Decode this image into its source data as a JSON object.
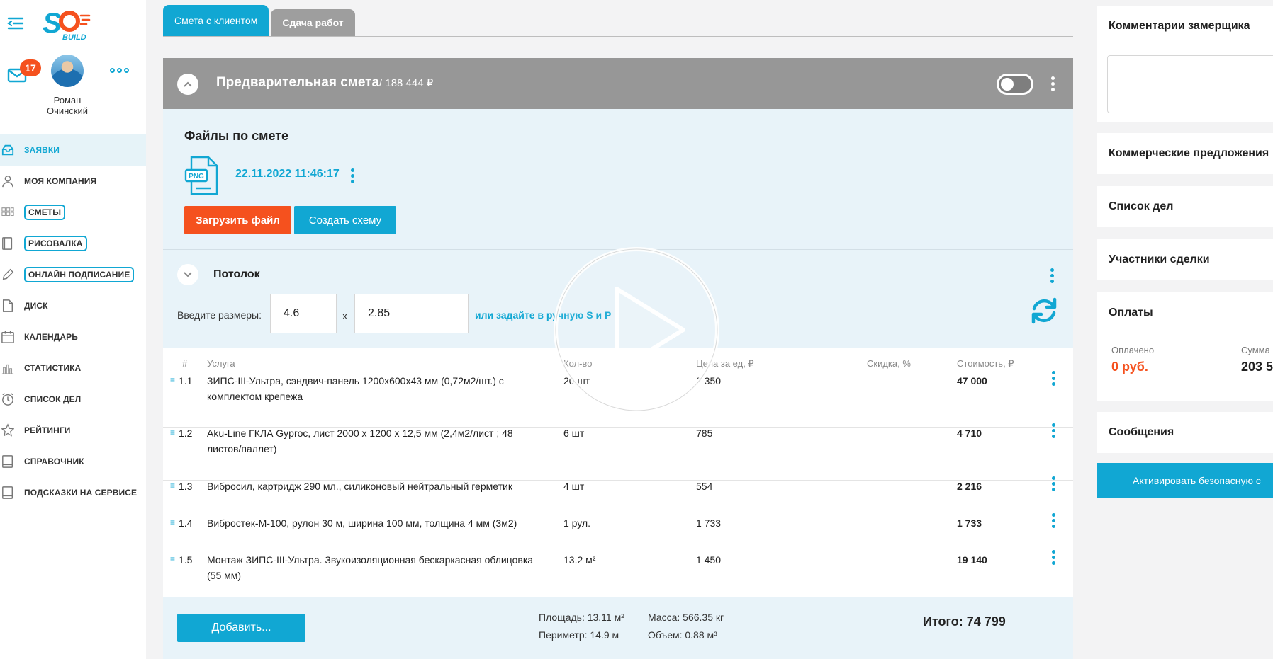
{
  "brand": {
    "logo_text": "SO BUILD"
  },
  "user": {
    "name": "Роман Очинский",
    "notifications": "17"
  },
  "sidebar": {
    "items": [
      {
        "label": "ЗАЯВКИ",
        "icon": "inbox-icon",
        "active": true
      },
      {
        "label": "МОЯ КОМПАНИЯ",
        "icon": "user-icon"
      },
      {
        "label": "СМЕТЫ",
        "icon": "grid-icon",
        "outlined": true
      },
      {
        "label": "РИСОВАЛКА",
        "icon": "book-icon",
        "outlined": true
      },
      {
        "label": "ОНЛАЙН ПОДПИСАНИЕ",
        "icon": "pencil-icon",
        "outlined": true
      },
      {
        "label": "ДИСК",
        "icon": "file-icon"
      },
      {
        "label": "КАЛЕНДАРЬ",
        "icon": "calendar-icon"
      },
      {
        "label": "СТАТИСТИКА",
        "icon": "chart-icon"
      },
      {
        "label": "СПИСОК ДЕЛ",
        "icon": "clock-icon"
      },
      {
        "label": "РЕЙТИНГИ",
        "icon": "star-icon"
      },
      {
        "label": "СПРАВОЧНИК",
        "icon": "book-icon"
      },
      {
        "label": "ПОДСКАЗКИ НА СЕРВИСЕ",
        "icon": "book-icon"
      }
    ]
  },
  "tabs": [
    {
      "label": "Смета с клиентом",
      "active": true
    },
    {
      "label": "Сдача работ",
      "active": false
    }
  ],
  "estimate": {
    "title": "Предварительная смета",
    "sum": "/ 188 444 ₽"
  },
  "files": {
    "title": "Файлы по смете",
    "file_type": "PNG",
    "file_date": "22.11.2022 11:46:17",
    "upload_label": "Загрузить файл",
    "scheme_label": "Создать схему"
  },
  "ceiling": {
    "title": "Потолок",
    "dims_label": "Введите размеры:",
    "width": "4.6",
    "x": "x",
    "length": "2.85",
    "manual_link": "или задайте в ручную S и P"
  },
  "table": {
    "headers": [
      "#",
      "Услуга",
      "Кол-во",
      "Цена за ед, ₽",
      "Скидка, %",
      "Стоимость, ₽"
    ],
    "rows": [
      {
        "num": "1.1",
        "service": "ЗИПС-III-Ультра, сэндвич-панель 1200х600х43 мм (0,72м2/шт.) с комплектом крепежа",
        "qty": "20 шт",
        "price": "2 350",
        "cost": "47 000"
      },
      {
        "num": "1.2",
        "service": "Aku-Line ГКЛА Gyproc, лист 2000 х 1200 х 12,5 мм (2,4м2/лист ; 48 листов/паллет)",
        "qty": "6 шт",
        "price": "785",
        "cost": "4 710"
      },
      {
        "num": "1.3",
        "service": "Вибросил, картридж 290 мл., силиконовый нейтральный герметик",
        "qty": "4 шт",
        "price": "554",
        "cost": "2 216"
      },
      {
        "num": "1.4",
        "service": "Вибростек-М-100, рулон 30 м, ширина 100 мм, толщина 4 мм (3м2)",
        "qty": "1 рул.",
        "price": "1 733",
        "cost": "1 733"
      },
      {
        "num": "1.5",
        "service": "Монтаж ЗИПС-III-Ультра. Звукоизоляционная бескаркасная облицовка (55 мм)",
        "qty": "13.2 м²",
        "price": "1 450",
        "cost": "19 140"
      }
    ],
    "handle": "≡"
  },
  "footer": {
    "add_label": "Добавить...",
    "area": "Площадь: 13.11 м²",
    "perimeter": "Периметр: 14.9 м",
    "mass": "Масса: 566.35 кг",
    "volume": "Объем: 0.88 м³",
    "total": "Итого: 74 799"
  },
  "right_panel": {
    "comments_title": "Комментарии замерщика",
    "offers_title": "Коммерческие предложения",
    "todo_title": "Список дел",
    "participants_title": "Участники сделки",
    "payments_title": "Оплаты",
    "paid_label": "Оплачено",
    "paid_value": "0 руб.",
    "sum_label": "Сумма",
    "sum_value": "203 5",
    "messages_title": "Сообщения",
    "activate_label": "Активировать безопасную с"
  },
  "colors": {
    "accent": "#11a7d3",
    "orange": "#f5511e",
    "header_gray": "#979797",
    "panel_bg": "#e8f3f9"
  }
}
